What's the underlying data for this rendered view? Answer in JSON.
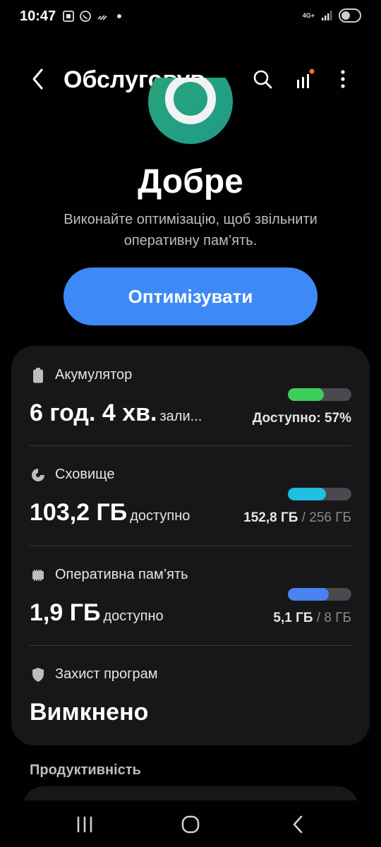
{
  "status_bar": {
    "time": "10:47",
    "network": "4G+"
  },
  "header": {
    "title": "Обслуговув..."
  },
  "hero": {
    "status": "Добре",
    "description": "Виконайте оптимізацію, щоб звільнити оперативну пам’ять.",
    "button_label": "Оптимізувати",
    "accent": "#3d8af7"
  },
  "card": {
    "battery": {
      "label": "Акумулятор",
      "value": "6 год. 4 хв.",
      "suffix": "зали...",
      "right_strong": "Доступно: 57%",
      "level_percent": 57,
      "color": "#3ecf5a"
    },
    "storage": {
      "label": "Сховище",
      "value": "103,2 ГБ",
      "suffix": "доступно",
      "used": "152,8 ГБ",
      "total": "/ 256 ГБ",
      "level_percent": 60,
      "color": "#1fbfe0"
    },
    "ram": {
      "label": "Оперативна пам’ять",
      "value": "1,9 ГБ",
      "suffix": "доступно",
      "used": "5,1 ГБ",
      "total": "/ 8 ГБ",
      "level_percent": 64,
      "color": "#4a82f0"
    },
    "app_protection": {
      "label": "Захист програм",
      "value": "Вимкнено"
    }
  },
  "section": {
    "title": "Продуктивність"
  }
}
